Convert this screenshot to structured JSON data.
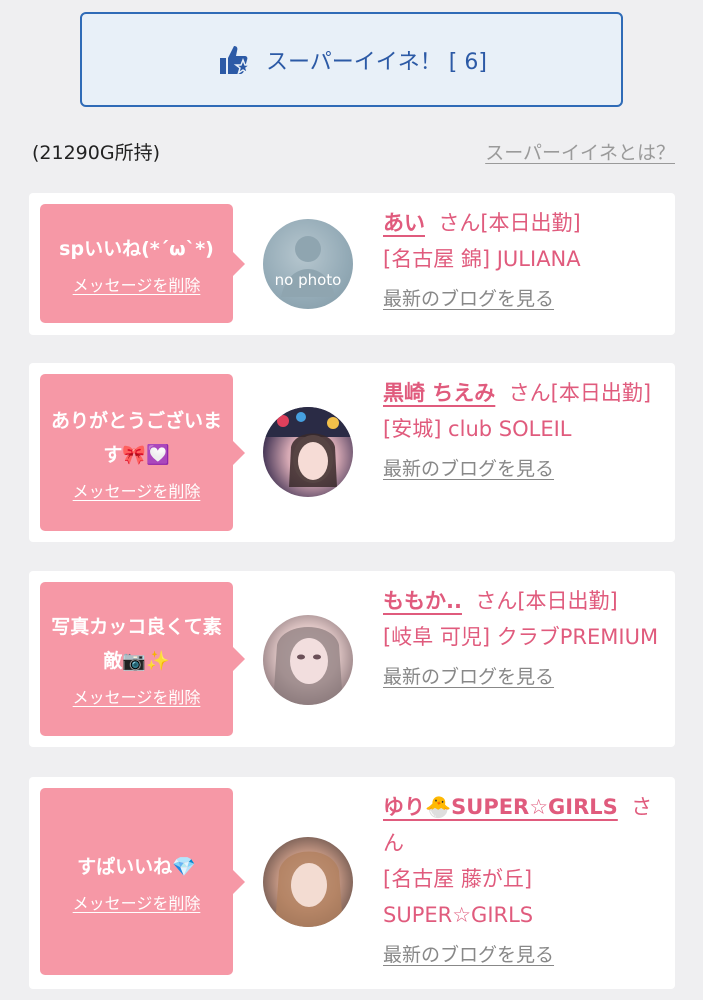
{
  "super_like": {
    "label": "スーパーイイネ！ [ 6]",
    "icon": "thumbs-up-star-icon"
  },
  "points": "(21290G所持)",
  "help_link": "スーパーイイネとは？",
  "items": [
    {
      "message": "spいいね(*´ω`*)",
      "delete": "メッセージを削除",
      "name": "あい",
      "san": "さん",
      "status": "[本日出勤]",
      "shop": "[名古屋 錦] JULIANA",
      "blog": "最新のブログを見る",
      "avatar_text": "no photo"
    },
    {
      "message": "ありがとうございます🎀💟",
      "delete": "メッセージを削除",
      "name": "黒崎 ちえみ",
      "san": "さん",
      "status": "[本日出勤]",
      "shop": "[安城] club SOLEIL",
      "blog": "最新のブログを見る"
    },
    {
      "message": "写真カッコ良くて素敵📷✨",
      "delete": "メッセージを削除",
      "name": "ももか..",
      "san": "さん",
      "status": "[本日出勤]",
      "shop": "[岐阜 可児] クラブPREMIUM",
      "blog": "最新のブログを見る"
    },
    {
      "message": "すぱいいね💎",
      "delete": "メッセージを削除",
      "name": "ゆり🐣SUPER☆GIRLS",
      "san": "さん",
      "status": "",
      "shop": "[名古屋 藤が丘] SUPER☆GIRLS",
      "blog": "最新のブログを見る"
    }
  ],
  "colors": {
    "pink": "#f698a6",
    "name_pink": "#e05b7d",
    "blue": "#2c5aa6"
  }
}
